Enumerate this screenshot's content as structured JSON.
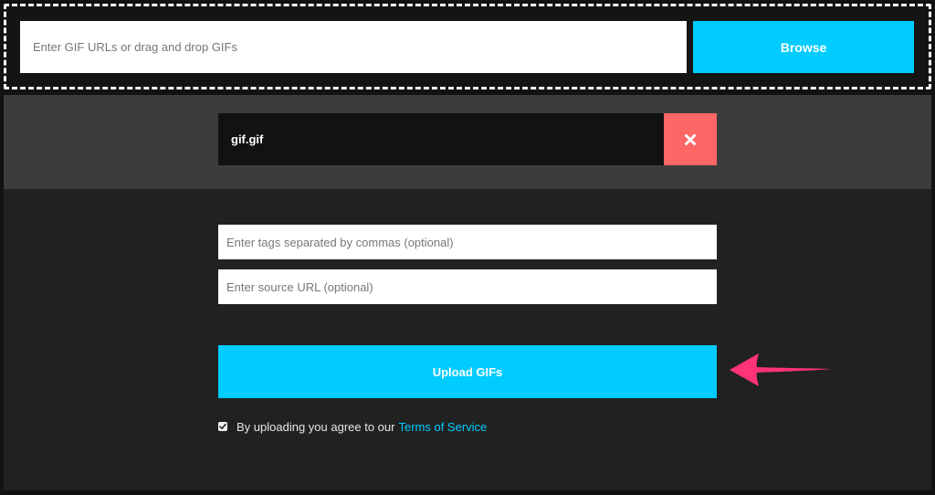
{
  "upload": {
    "url_placeholder": "Enter GIF URLs or drag and drop GIFs",
    "browse_label": "Browse"
  },
  "files": [
    {
      "name": "gif.gif"
    }
  ],
  "form": {
    "tags_placeholder": "Enter tags separated by commas (optional)",
    "source_placeholder": "Enter source URL (optional)",
    "upload_label": "Upload GIFs",
    "agree_text": "By uploading you agree to our",
    "tos_link": "Terms of Service",
    "agree_checked": true
  },
  "colors": {
    "accent": "#00ccff",
    "remove": "#ff6666",
    "arrow": "#ff3377"
  },
  "icons": {
    "remove": "close-icon",
    "checkbox": "check-icon",
    "annotation": "arrow-left-icon"
  }
}
